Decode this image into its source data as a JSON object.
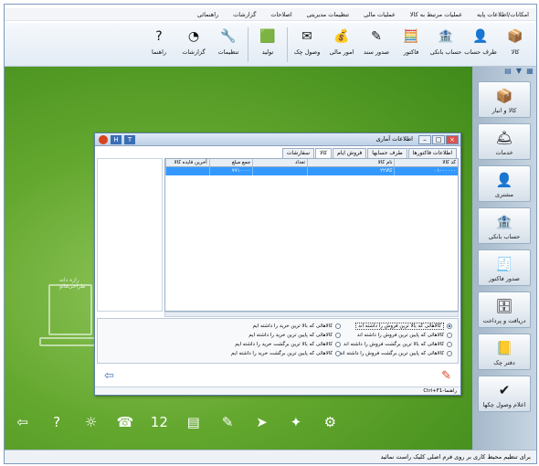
{
  "menu": [
    "امکانات/اطلاعات پایه",
    "عملیات مرتبط به کالا",
    "عملیات مالی",
    "تنظیمات مدیریتی",
    "اصلاحات",
    "گزارشات",
    "راهنمائی"
  ],
  "ribbon": [
    {
      "label": "کالا",
      "icon": "package-icon",
      "glyph": "📦"
    },
    {
      "label": "طرف حساب",
      "icon": "person-icon",
      "glyph": "👤"
    },
    {
      "label": "حساب بانکی",
      "icon": "bank-icon",
      "glyph": "🏦"
    },
    {
      "label": "فاکتور",
      "icon": "calculator-icon",
      "glyph": "🧮"
    },
    {
      "label": "صدور سند",
      "icon": "pen-icon",
      "glyph": "✎"
    },
    {
      "label": "امور مالی",
      "icon": "finance-icon",
      "glyph": "💰"
    },
    {
      "label": "وصول چک",
      "icon": "check-icon",
      "glyph": "✉"
    },
    {
      "label": "تولید",
      "icon": "cube-icon",
      "glyph": "🟩"
    },
    {
      "label": "تنظیمات",
      "icon": "tools-icon",
      "glyph": "🔧"
    },
    {
      "label": "گزارشات",
      "icon": "pie-chart-icon",
      "glyph": "◔"
    },
    {
      "label": "راهنما",
      "icon": "help-icon",
      "glyph": "?"
    }
  ],
  "sidebar": [
    {
      "label": "کالا و انبار",
      "icon": "box-icon",
      "glyph": "📦"
    },
    {
      "label": "خدمات",
      "icon": "service-icon",
      "glyph": "🛎"
    },
    {
      "label": "مشتری",
      "icon": "customer-icon",
      "glyph": "👤"
    },
    {
      "label": "حساب بانکی",
      "icon": "bank-icon",
      "glyph": "🏦"
    },
    {
      "label": "صدور فاکتور",
      "icon": "invoice-icon",
      "glyph": "🧾"
    },
    {
      "label": "دریافت و پرداخت",
      "icon": "cashbox-icon",
      "glyph": "🗄"
    },
    {
      "label": "دفتر چک",
      "icon": "checkbook-icon",
      "glyph": "📒"
    },
    {
      "label": "اعلام وصول چکها",
      "icon": "check-cash-icon",
      "glyph": "✔"
    }
  ],
  "desktop": {
    "laptop_label": "رازه دانه طراحی‌هائو"
  },
  "status_text": "برای تنظیم محیط کاری بر روی فرم اصلی کلیک راست نمائید",
  "dock": [
    "exit-icon",
    "help-icon",
    "weather-icon",
    "phone-icon",
    "calendar-icon",
    "calculator-icon",
    "notes-icon",
    "telegram-icon",
    "wind-icon",
    "tools-icon"
  ],
  "dock_glyphs": [
    "⇦",
    "?",
    "☼",
    "☎",
    "12",
    "▤",
    "✎",
    "➤",
    "✦",
    "⚙"
  ],
  "window": {
    "title": "اطلاعات آماری",
    "tabs": [
      "اطلاعات فاکتورها",
      "طرف حسابها",
      "فروش ایام",
      "کالا",
      "سفارشات"
    ],
    "active_tab": 3,
    "columns": [
      "کد کالا",
      "نام کالا",
      "تعداد",
      "جمع مبلغ",
      "آخرین فایده کالا"
    ],
    "row": [
      "۰۱۰۰۰۰۰۰",
      "کالا۲۲",
      "",
      "۷۷۱۰۰۰۰",
      ""
    ],
    "options": [
      {
        "label": "کالاهائی که بالا ترین فروش را داشته اند",
        "selected": true
      },
      {
        "label": "کالاهائی که بالا ترین خرید را داشته ایم",
        "selected": false
      },
      {
        "label": "کالاهائی که پایین ترین فروش را داشته اند",
        "selected": false
      },
      {
        "label": "کالاهائی که پایین ترین خرید را داشته ایم",
        "selected": false
      },
      {
        "label": "کالاهائی که بالا ترین برگشت فروش را داشته اند",
        "selected": false
      },
      {
        "label": "کالاهائی که بالا ترین برگشت خرید را داشته ایم",
        "selected": false
      },
      {
        "label": "کالاهائی که پایین ترین برگشت فروش را داشته اند",
        "selected": false
      },
      {
        "label": "کالاهائی که پایین ترین برگشت خرید را داشته ایم",
        "selected": false
      }
    ],
    "footer": "راهنما-Ctrl+F1"
  }
}
